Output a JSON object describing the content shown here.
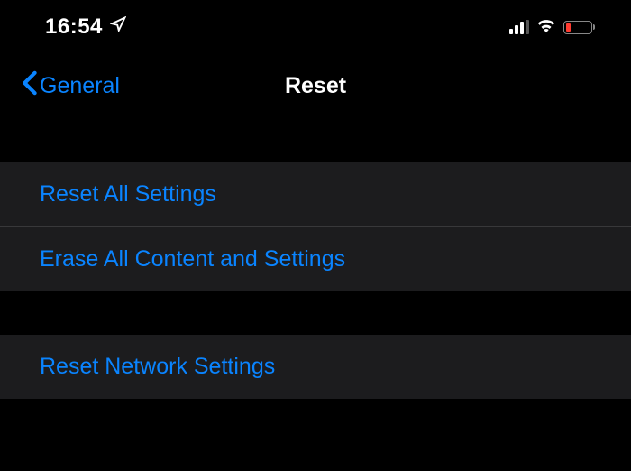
{
  "statusBar": {
    "time": "16:54",
    "locationIcon": "location-arrow"
  },
  "navBar": {
    "backLabel": "General",
    "title": "Reset"
  },
  "group1": {
    "items": [
      {
        "label": "Reset All Settings"
      },
      {
        "label": "Erase All Content and Settings"
      }
    ]
  },
  "group2": {
    "items": [
      {
        "label": "Reset Network Settings"
      }
    ]
  },
  "colors": {
    "accent": "#0a84ff",
    "background": "#000000",
    "cellBackground": "#1c1c1e",
    "batteryLow": "#ff3b30"
  }
}
